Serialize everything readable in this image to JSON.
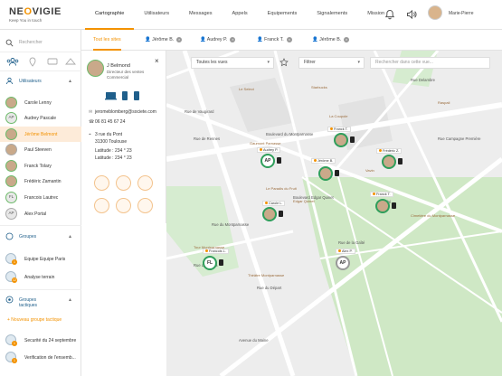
{
  "header": {
    "logo_prefix": "NE",
    "logo_o": "O",
    "logo_suffix": "VIGIE",
    "tagline": "Keep You in touch",
    "nav": [
      "Cartographie",
      "Utilisateurs",
      "Messages",
      "Appels",
      "Equipements",
      "Signalements",
      "Mission"
    ],
    "user_name": "Marie-Pierre"
  },
  "sidebar": {
    "search_placeholder": "Rechercher",
    "users_section": "Utilisateurs",
    "users": [
      {
        "name": "Carole Lenny",
        "initials": ""
      },
      {
        "name": "Audrey Pascale",
        "initials": "AP"
      },
      {
        "name": "Jérôme Belmont",
        "initials": ""
      },
      {
        "name": "Paul Steeven",
        "initials": ""
      },
      {
        "name": "Franck Tolary",
        "initials": ""
      },
      {
        "name": "Frédéric Zamantin",
        "initials": ""
      },
      {
        "name": "Francois Lautrec",
        "initials": "FL"
      },
      {
        "name": "Alex Portal",
        "initials": "AP"
      }
    ],
    "groups_section": "Groupes",
    "groups": [
      {
        "name": "Equipe Equipe Paris",
        "badge": "1"
      },
      {
        "name": "Analyse terrain",
        "badge": "12"
      }
    ],
    "tactical_section": "Groupes tactiques",
    "new_group": "+ Nouveau groupe tactique",
    "tactical": [
      {
        "name": "Securité du 24 septembre",
        "badge": "1"
      },
      {
        "name": "Verification de l'ensemb...",
        "badge": "1"
      }
    ]
  },
  "sites_bar": {
    "tabs": [
      {
        "label": "Tout les sites",
        "closable": false
      },
      {
        "label": "Jérôme B.",
        "closable": true
      },
      {
        "label": "Audrey P.",
        "closable": true
      },
      {
        "label": "Franck T.",
        "closable": true
      },
      {
        "label": "Jérôme B.",
        "closable": true
      }
    ]
  },
  "detail": {
    "name": "J Belmond",
    "role1": "Directeur des ventes",
    "role2": "Commercial",
    "email": "jeromeblomberg@societe.com",
    "phone": "06 81 45 67 24",
    "address1": "3 rue du Pont",
    "address2": "31300 Toulouse",
    "latitude1": "Latitude : 234 ° 23",
    "latitude2": "Latitude : 234 ° 23"
  },
  "map_controls": {
    "views": "Toutes les vues",
    "filter": "Filtrer",
    "search_placeholder": "Rechercher dans cette vue..."
  },
  "map": {
    "pins": [
      {
        "initials": "",
        "label": "Franck T.",
        "photo": true
      },
      {
        "initials": "",
        "label": "Frédéric Z.",
        "photo": true
      },
      {
        "initials": "AP",
        "label": "Audrey P.",
        "photo": false
      },
      {
        "initials": "",
        "label": "Jérôme B.",
        "photo": true
      },
      {
        "initials": "",
        "label": "Franck T.",
        "photo": true
      },
      {
        "initials": "",
        "label": "Carole L.",
        "photo": true
      },
      {
        "initials": "FL",
        "label": "Francois L.",
        "photo": false
      },
      {
        "initials": "AP",
        "label": "Alex P.",
        "photo": false
      }
    ],
    "streets": [
      "Rue de Rennes",
      "Boulevard du Montparnasse",
      "Rue du Montparnasse",
      "Rue Delambre",
      "Gaîté",
      "Avenue du Maine",
      "Rue de la Gaîté",
      "Boulevard Edgar Quinet",
      "Rue du Départ",
      "Rue d'Odessa",
      "Rue de Vaugirard",
      "Rue Campagne Première"
    ],
    "pois": [
      "Gaumont Parnasse",
      "Théâtre Montparnasse",
      "Cimetière du Montparnasse",
      "Edgar Quinet",
      "Starbucks",
      "Le Paradis du Fruit",
      "Tour Montparnasse",
      "Vavin",
      "Raspail",
      "Le Select",
      "La Coupole"
    ]
  }
}
